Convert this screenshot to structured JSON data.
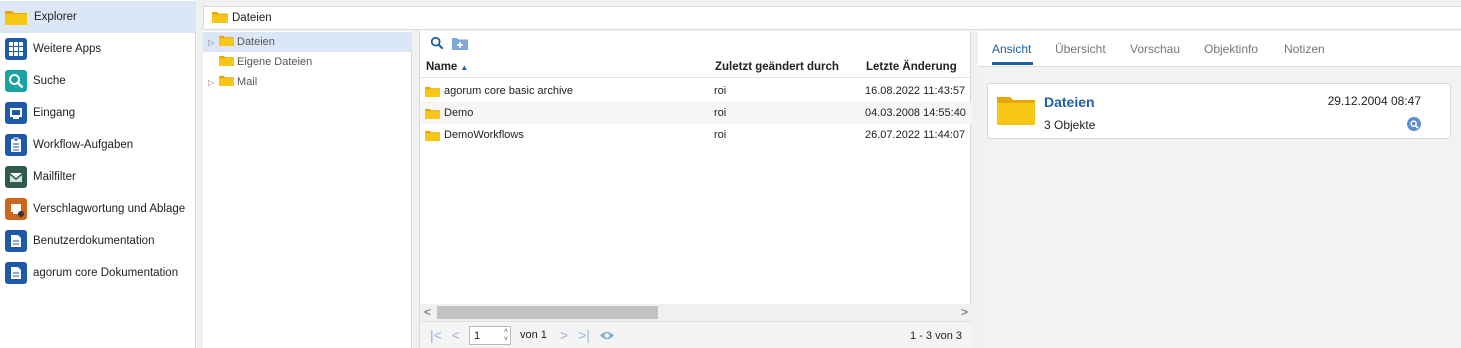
{
  "nav": {
    "items": [
      {
        "label": "Explorer",
        "icon": "folder-icon",
        "color": "#f5c518"
      },
      {
        "label": "Weitere Apps",
        "icon": "apps-grid-icon",
        "color": "#1e5aa8"
      },
      {
        "label": "Suche",
        "icon": "search-icon",
        "color": "#1aa3a3"
      },
      {
        "label": "Eingang",
        "icon": "inbox-icon",
        "color": "#1e5aa8"
      },
      {
        "label": "Workflow-Aufgaben",
        "icon": "clipboard-icon",
        "color": "#1e5aa8"
      },
      {
        "label": "Mailfilter",
        "icon": "mailfilter-icon",
        "color": "#2f5b4f"
      },
      {
        "label": "Verschlagwortung und Ablage",
        "icon": "tagging-icon",
        "color": "#d0661b"
      },
      {
        "label": "Benutzerdokumentation",
        "icon": "document-link-icon",
        "color": "#1e5aa8"
      },
      {
        "label": "agorum core Dokumentation",
        "icon": "document-link-icon",
        "color": "#1e5aa8"
      }
    ]
  },
  "breadcrumb": {
    "label": "Dateien"
  },
  "tree": {
    "items": [
      {
        "label": "Dateien",
        "expandable": true,
        "selected": true
      },
      {
        "label": "Eigene Dateien",
        "expandable": false,
        "selected": false
      },
      {
        "label": "Mail",
        "expandable": true,
        "selected": false
      }
    ]
  },
  "list": {
    "columns": {
      "name": "Name",
      "changed_by": "Zuletzt geändert durch",
      "last_change": "Letzte Änderung"
    },
    "sort_indicator": "▲",
    "rows": [
      {
        "name": "agorum core basic archive",
        "changed_by": "roi",
        "last_change": "16.08.2022 11:43:57"
      },
      {
        "name": "Demo",
        "changed_by": "roi",
        "last_change": "04.03.2008 14:55:40"
      },
      {
        "name": "DemoWorkflows",
        "changed_by": "roi",
        "last_change": "26.07.2022 11:44:07"
      }
    ],
    "pager": {
      "page_value": "1",
      "of_label": "von 1",
      "summary": "1 - 3 von 3"
    }
  },
  "details": {
    "tabs": [
      "Ansicht",
      "Übersicht",
      "Vorschau",
      "Objektinfo",
      "Notizen"
    ],
    "active_tab": "Ansicht",
    "card": {
      "title": "Dateien",
      "date": "29.12.2004 08:47",
      "subtitle": "3 Objekte"
    }
  },
  "colors": {
    "accent": "#1d5fa5",
    "folder": "#f5c518",
    "selection": "#dbe7f6"
  }
}
